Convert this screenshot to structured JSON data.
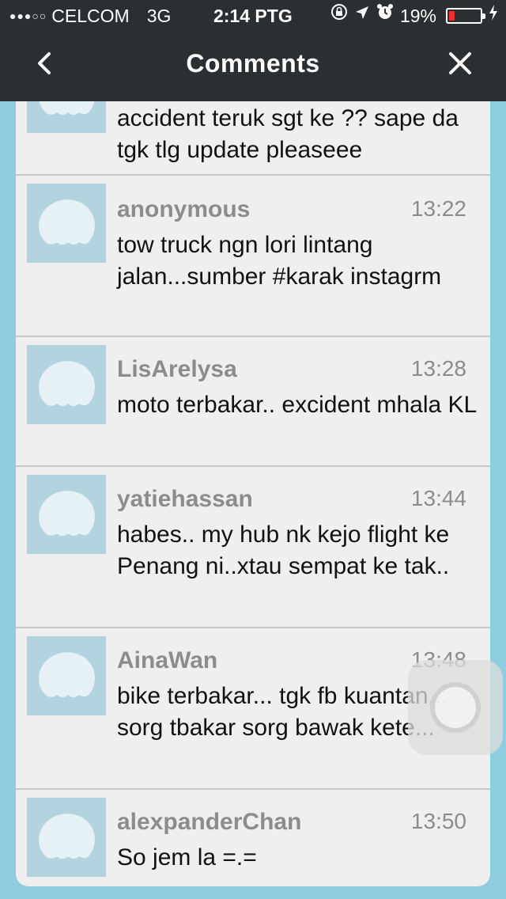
{
  "status": {
    "signal_dots": "●●●○○",
    "carrier": "CELCOM",
    "network": "3G",
    "time": "2:14 PTG",
    "battery": "19%",
    "battery_level": 0.19
  },
  "nav": {
    "title": "Comments",
    "back_icon": "chevron-left-icon",
    "close_icon": "close-icon"
  },
  "comments": [
    {
      "username": "",
      "time": "",
      "text": "accident teruk sgt ke ?? sape da tgk tlg update pleaseee"
    },
    {
      "username": "anonymous",
      "time": "13:22",
      "text": "tow truck ngn lori lintang jalan...sumber #karak instagrm"
    },
    {
      "username": "LisArelysa",
      "time": "13:28",
      "text": "moto terbakar.. excident mhala KL"
    },
    {
      "username": "yatiehassan",
      "time": "13:44",
      "text": "habes.. my hub nk kejo flight ke Penang ni..xtau sempat ke tak.."
    },
    {
      "username": "AinaWan",
      "time": "13:48",
      "text": "bike terbakar... tgk fb kuantan... sorg tbakar sorg bawak kete..."
    },
    {
      "username": "alexpanderChan",
      "time": "13:50",
      "text": "So jem la =.="
    }
  ],
  "colors": {
    "bar": "#2b2f31",
    "background": "#8fcde0",
    "card": "#efefef",
    "avatar": "#b3d4de"
  }
}
